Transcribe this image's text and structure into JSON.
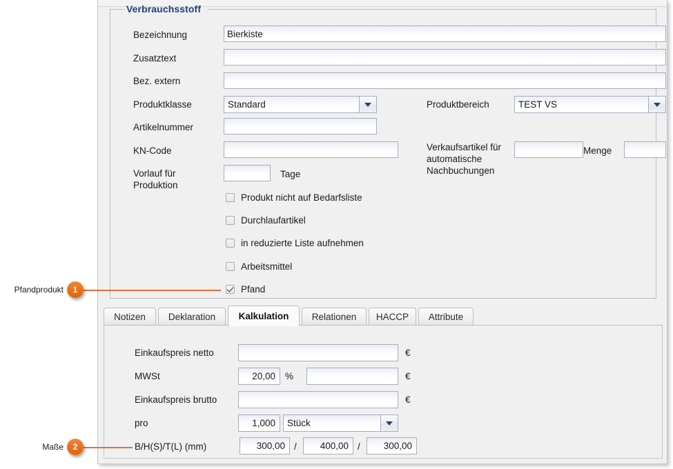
{
  "group": {
    "title": "Verbrauchsstoff",
    "fields": {
      "bezeichnung_label": "Bezeichnung",
      "bezeichnung_value": "Bierkiste",
      "zusatztext_label": "Zusatztext",
      "zusatztext_value": "",
      "bez_extern_label": "Bez. extern",
      "bez_extern_value": "",
      "produktklasse_label": "Produktklasse",
      "produktklasse_value": "Standard",
      "produktbereich_label": "Produktbereich",
      "produktbereich_value": "TEST VS",
      "artikelnummer_label": "Artikelnummer",
      "artikelnummer_value": "",
      "kn_code_label": "KN-Code",
      "kn_code_value": "",
      "verkaufsartikel_label": "Verkaufsartikel für automatische Nachbuchungen",
      "verkaufsartikel_value": "",
      "menge_label": "Menge",
      "menge_value": "",
      "vorlauf_label": "Vorlauf für Produktion",
      "vorlauf_value": "",
      "tage_label": "Tage"
    },
    "checkboxes": [
      {
        "label": "Produkt nicht auf Bedarfsliste",
        "checked": false
      },
      {
        "label": "Durchlaufartikel",
        "checked": false
      },
      {
        "label": "in reduzierte Liste aufnehmen",
        "checked": false
      },
      {
        "label": "Arbeitsmittel",
        "checked": false
      },
      {
        "label": "Pfand",
        "checked": true
      }
    ]
  },
  "tabs": [
    {
      "label": "Notizen",
      "active": false
    },
    {
      "label": "Deklaration",
      "active": false
    },
    {
      "label": "Kalkulation",
      "active": true
    },
    {
      "label": "Relationen",
      "active": false
    },
    {
      "label": "HACCP",
      "active": false
    },
    {
      "label": "Attribute",
      "active": false
    }
  ],
  "kalkulation": {
    "einkaufspreis_netto_label": "Einkaufspreis netto",
    "einkaufspreis_netto_value": "",
    "mwst_label": "MWSt",
    "mwst_percent_value": "20,00",
    "percent_sign": "%",
    "mwst_amount_value": "",
    "einkaufspreis_brutto_label": "Einkaufspreis brutto",
    "einkaufspreis_brutto_value": "",
    "pro_label": "pro",
    "pro_value": "1,000",
    "pro_unit_value": "Stück",
    "dimension_label": "B/H(S)/T(L) (mm)",
    "dimension_b": "300,00",
    "dimension_h": "400,00",
    "dimension_t": "300,00",
    "currency_symbol": "€",
    "separator": "/"
  },
  "callouts": [
    {
      "number": "1",
      "text": "Pfandprodukt"
    },
    {
      "number": "2",
      "text": "Maße"
    }
  ],
  "colors": {
    "accent": "#e2703a",
    "badge": "#e8701a",
    "group_title": "#1f3f80",
    "panel_bg": "#f0f0f0"
  }
}
